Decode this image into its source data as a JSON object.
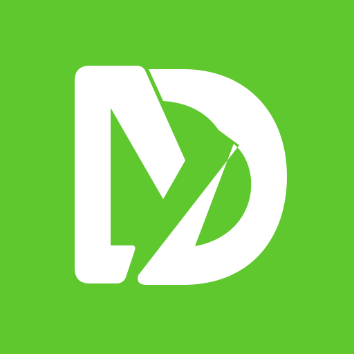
{
  "icon": {
    "name": "md-monogram-logo-icon",
    "background_color": "#5ec82e",
    "foreground_color": "#ffffff"
  }
}
